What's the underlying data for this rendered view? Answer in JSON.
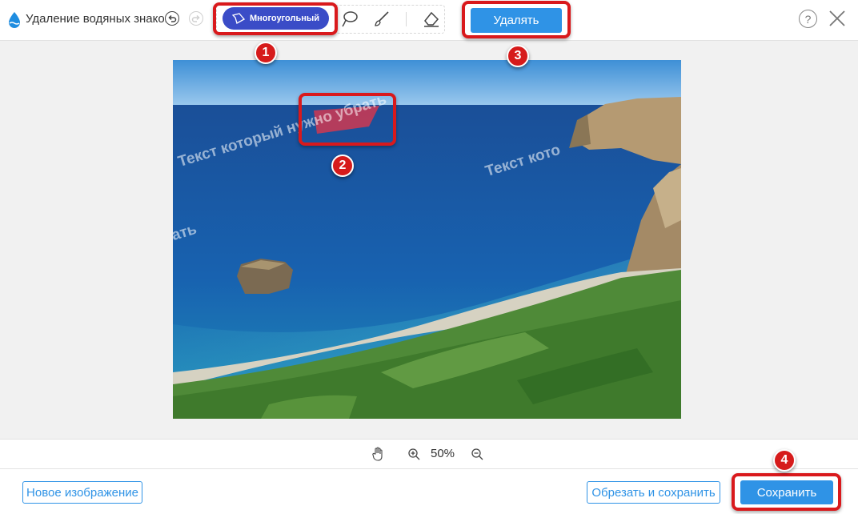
{
  "app": {
    "title": "Удаление водяных знаков"
  },
  "toolbar": {
    "polygon_label": "Многоугольный",
    "delete_label": "Удалять",
    "help_label": "?"
  },
  "canvas": {
    "watermark_texts": [
      "Текст который нужно убрать",
      "Текст кото",
      "ать"
    ]
  },
  "zoom": {
    "value": "50%"
  },
  "footer": {
    "new_image_label": "Новое изображение",
    "crop_save_label": "Обрезать и сохранить",
    "save_label": "Сохранить"
  },
  "annotations": {
    "badges": [
      "1",
      "2",
      "3",
      "4"
    ]
  },
  "colors": {
    "accent": "#2f93e6",
    "tool_active": "#3a4cc7",
    "highlight": "#d9191c",
    "selection_fill": "#e0364a"
  }
}
